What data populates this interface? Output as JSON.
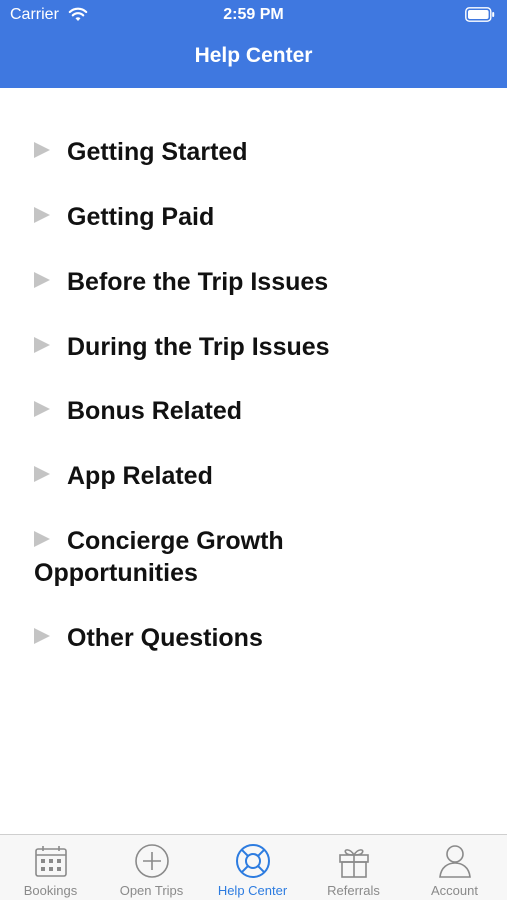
{
  "status_bar": {
    "carrier": "Carrier",
    "time": "2:59 PM"
  },
  "header": {
    "title": "Help Center",
    "background_color": "#3f78e0"
  },
  "topics": [
    {
      "label": "Getting Started"
    },
    {
      "label": "Getting Paid"
    },
    {
      "label": "Before the Trip Issues"
    },
    {
      "label": "During the Trip Issues"
    },
    {
      "label": "Bonus Related"
    },
    {
      "label": "App Related"
    },
    {
      "label": "Concierge Growth Opportunities"
    },
    {
      "label": "Other Questions"
    }
  ],
  "tab_bar": {
    "active_color": "#2d7ce0",
    "inactive_color": "#8a8a8a",
    "tabs": [
      {
        "label": "Bookings",
        "icon": "calendar-icon",
        "active": false
      },
      {
        "label": "Open Trips",
        "icon": "plus-circle-icon",
        "active": false
      },
      {
        "label": "Help Center",
        "icon": "lifebuoy-icon",
        "active": true
      },
      {
        "label": "Referrals",
        "icon": "gift-icon",
        "active": false
      },
      {
        "label": "Account",
        "icon": "person-icon",
        "active": false
      }
    ]
  }
}
